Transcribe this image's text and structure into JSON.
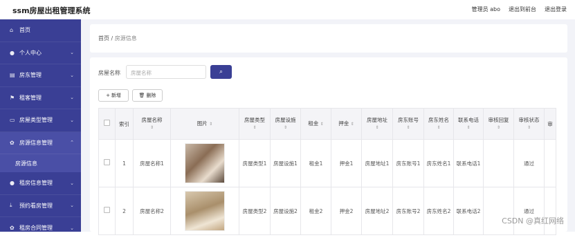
{
  "app": {
    "title": "ssm房屋出租管理系统"
  },
  "topnav": {
    "admin": "管理员 abo",
    "front": "退出到前台",
    "logout": "退出登录"
  },
  "sidebar": {
    "items": [
      {
        "label": "首页",
        "icon": "home-icon"
      },
      {
        "label": "个人中心",
        "icon": "user-icon"
      },
      {
        "label": "房东管理",
        "icon": "building-icon"
      },
      {
        "label": "租客管理",
        "icon": "flag-icon"
      },
      {
        "label": "房屋类型管理",
        "icon": "chat-icon"
      },
      {
        "label": "房源信息管理",
        "icon": "gear-icon"
      },
      {
        "label": "房源信息"
      },
      {
        "label": "租房信息管理",
        "icon": "user-icon"
      },
      {
        "label": "预约看房管理",
        "icon": "download-icon"
      },
      {
        "label": "租房合同管理",
        "icon": "gear-icon"
      }
    ]
  },
  "breadcrumb": {
    "home": "首页",
    "sep": "/",
    "current": "房源信息"
  },
  "search": {
    "label": "房屋名称",
    "placeholder": "房屋名称"
  },
  "actions": {
    "add": "新增",
    "delete": "删除"
  },
  "table": {
    "headers": [
      "索引",
      "房屋名称",
      "图片",
      "房屋类型",
      "房屋设施",
      "租金",
      "押金",
      "房屋地址",
      "房东账号",
      "房东姓名",
      "联系电话",
      "审核回复",
      "审核状态",
      "审"
    ],
    "rows": [
      {
        "index": "1",
        "name": "房屋名称1",
        "type": "房屋类型1",
        "facility": "房屋设施1",
        "rent": "租金1",
        "deposit": "押金1",
        "address": "房屋地址1",
        "account": "房东账号1",
        "owner": "房东姓名1",
        "phone": "联系电话1",
        "reply": "",
        "status": "通过"
      },
      {
        "index": "2",
        "name": "房屋名称2",
        "type": "房屋类型2",
        "facility": "房屋设施2",
        "rent": "租金2",
        "deposit": "押金2",
        "address": "房屋地址2",
        "account": "房东账号2",
        "owner": "房东姓名2",
        "phone": "联系电话2",
        "reply": "",
        "status": "通过"
      }
    ]
  },
  "watermark": "CSDN @真红网络",
  "colors": {
    "sidebar": "#3a3f95",
    "accent": "#3a3f95"
  }
}
